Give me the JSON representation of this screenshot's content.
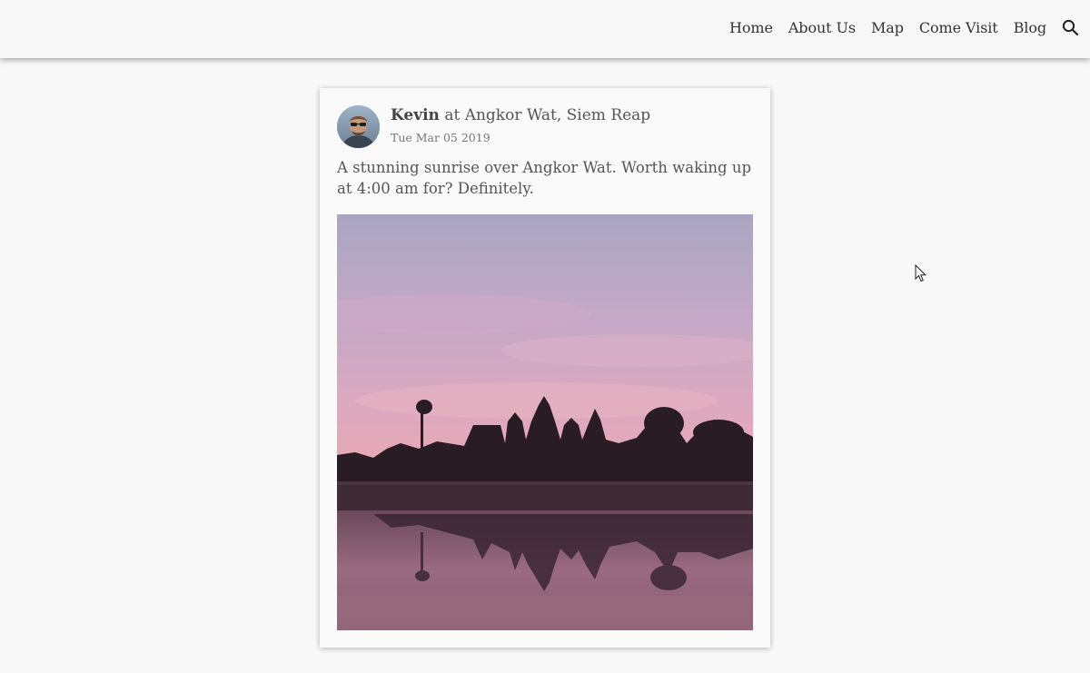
{
  "nav": {
    "items": [
      "Home",
      "About Us",
      "Map",
      "Come Visit",
      "Blog"
    ],
    "search_icon": "search-icon"
  },
  "post": {
    "author": "Kevin",
    "location_prefix": "at",
    "location": "Angkor Wat, Siem Reap",
    "date": "Tue Mar 05 2019",
    "caption": "A stunning sunrise over Angkor Wat. Worth waking up at 4:00 am for? Definitely."
  },
  "colors": {
    "background": "#f8f8f8",
    "card": "#fafafa",
    "text": "#555555"
  }
}
